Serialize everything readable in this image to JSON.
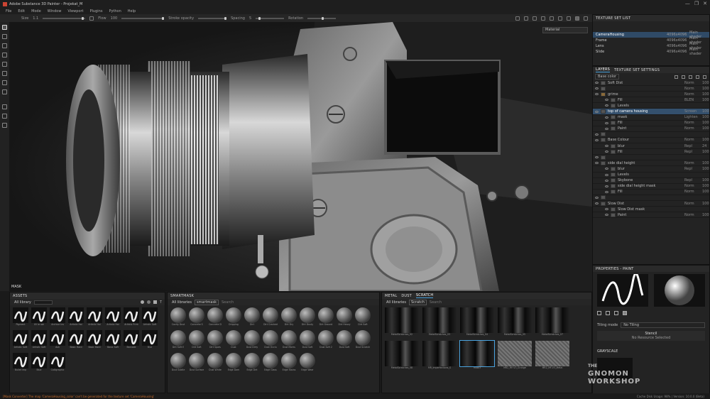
{
  "app": {
    "title": "Adobe Substance 3D Painter - Projekat_M",
    "window_controls": [
      "—",
      "❐",
      "✕"
    ]
  },
  "menu": [
    "File",
    "Edit",
    "Mode",
    "Window",
    "Viewport",
    "Plugins",
    "Python",
    "Help"
  ],
  "toolbar": {
    "size_label": "Size",
    "flow_label": "Flow",
    "stroke_opacity_label": "Stroke opacity",
    "spacing_label": "Spacing",
    "rotation_label": "Rotation",
    "size_value": "1.1",
    "flow_value": "100",
    "spacing_value": "5"
  },
  "viewport": {
    "material_select": "Material",
    "mask_label": "MASK"
  },
  "texture_set_list": {
    "title": "TEXTURE SET LIST",
    "rows": [
      {
        "name": "CameraHousing",
        "res": "4096x4096",
        "shader": "Main shader"
      },
      {
        "name": "Frame",
        "res": "4096x4096",
        "shader": "Main shader"
      },
      {
        "name": "Lens",
        "res": "4096x4096",
        "shader": "Main shader"
      },
      {
        "name": "Slide",
        "res": "4096x4096",
        "shader": "Main shader"
      }
    ]
  },
  "layers": {
    "tabs": [
      "LAYERS",
      "TEXTURE SET SETTINGS"
    ],
    "base_color": "Base color",
    "rows": [
      {
        "name": "Soft Dist",
        "blend": "Norm",
        "op": "100"
      },
      {
        "name": "",
        "blend": "Norm",
        "op": "100"
      },
      {
        "name": "grime",
        "blend": "Norm",
        "op": "100"
      },
      {
        "name": "Fill",
        "blend": "BLEN",
        "op": "100"
      },
      {
        "name": "Levels",
        "blend": "",
        "op": ""
      },
      {
        "name": "top of camera housing",
        "blend": "Screen",
        "op": "100"
      },
      {
        "name": "mask",
        "blend": "Lighten",
        "op": "100"
      },
      {
        "name": "Fill",
        "blend": "Norm",
        "op": "100"
      },
      {
        "name": "Paint",
        "blend": "Norm",
        "op": "100"
      },
      {
        "name": "",
        "blend": "",
        "op": ""
      },
      {
        "name": "Base Colour",
        "blend": "Norm",
        "op": "100"
      },
      {
        "name": "blur",
        "blend": "Repl",
        "op": "24"
      },
      {
        "name": "Fill",
        "blend": "Repl",
        "op": "100"
      },
      {
        "name": "",
        "blend": "",
        "op": ""
      },
      {
        "name": "side dial height",
        "blend": "Norm",
        "op": "100"
      },
      {
        "name": "blur",
        "blend": "Repl",
        "op": "100"
      },
      {
        "name": "Levels",
        "blend": "",
        "op": ""
      },
      {
        "name": "Skybone",
        "blend": "Repl",
        "op": "100"
      },
      {
        "name": "side dial height mask",
        "blend": "Norm",
        "op": "100"
      },
      {
        "name": "Fill",
        "blend": "Norm",
        "op": "100"
      },
      {
        "name": "",
        "blend": "",
        "op": ""
      },
      {
        "name": "Slow Dist",
        "blend": "Norm",
        "op": "100"
      },
      {
        "name": "Slow Dist mask",
        "blend": "",
        "op": ""
      },
      {
        "name": "Paint",
        "blend": "Norm",
        "op": "100"
      }
    ]
  },
  "properties": {
    "title": "PROPERTIES - PAINT",
    "tiling_mode_label": "Tiling mode",
    "tiling_mode_value": "No Tiling",
    "stencil_label": "Stencil",
    "stencil_value": "No Resource Selected",
    "grayscale_label": "GRAYSCALE"
  },
  "assets": {
    "title": "ASSETS",
    "filter": "All library",
    "items": [
      "Pigment",
      "UV brush",
      "Archive tra",
      "Artistic Hai",
      "Artistic Hai",
      "Artistic Hai",
      "Artistic Print",
      "Artistic Soft",
      "Artistic Soft",
      "Artistic Soft",
      "Ash",
      "Basic Hard",
      "Basic Hard",
      "Basic Soft",
      "Barcode",
      "Blur",
      "Bullet imp",
      "Blue",
      "Calligraphic"
    ]
  },
  "smart": {
    "title": "SMARTMASK",
    "filter": "All libraries",
    "search_tag": "smartmask",
    "search_label": "Search",
    "items": [
      "Cavity Dust",
      "Concrete S",
      "Concrete D",
      "Dripping",
      "Dirt",
      "Dirt Cracked",
      "Dirt Dry",
      "Dirt Dusty",
      "Dirt Ground",
      "Dirt Heavy",
      "Dirt Soft",
      "Dirt Soft E",
      "Dirt Soft",
      "Dirt Spots",
      "Dust",
      "Dust Dirty",
      "Dust Occlu",
      "Dust Marks",
      "Dust Soft",
      "Dust Soft 2",
      "Dust Soft",
      "Dust Scratch",
      "Dust Subtle",
      "Dust Surface",
      "Dust White",
      "Edge Dam",
      "Edge Dirt",
      "Edge Glass",
      "Edge Stains",
      "Edge Wear"
    ]
  },
  "scratch": {
    "tabs": [
      "METAL",
      "DUST",
      "SCRATCH"
    ],
    "filter": "All libraries",
    "search_tag": "Scratch",
    "search_label": "Search",
    "items": [
      "MetalScratches_02",
      "MetalScratches_03",
      "MetalScratches_04",
      "MetalScratches_05",
      "MetalScratches_07",
      "MetalScratches_08",
      "MR_Imperfections_S",
      "mask3",
      "MR2_MF-V3_Grunge",
      "MR2_MF-V3_Metal"
    ]
  },
  "status": {
    "message": "[Mask Converter] The map 'CameraHousing_color' can't be generated for the texture set 'CameraHousing'",
    "right": "Cache Disk Usage: 98% | Version: 10.0.0 (Beta)"
  },
  "logo": {
    "line1": "THE",
    "line2": "GNOMON",
    "line3": "WORKSHOP"
  }
}
